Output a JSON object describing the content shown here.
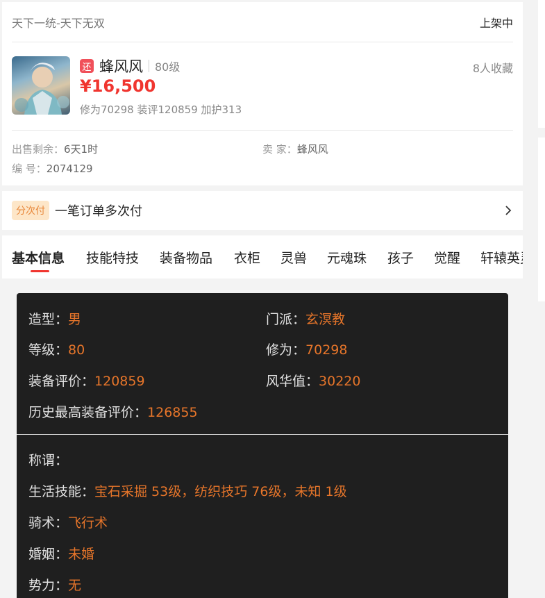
{
  "header": {
    "server": "天下一统-天下无双",
    "status": "上架中"
  },
  "role": {
    "badge": "还",
    "name": "蜂风风",
    "level": "80级",
    "favorites": "8人收藏",
    "price": "¥16,500",
    "summary": "修为70298 装评120859 加护313"
  },
  "meta": {
    "remaining_label": "出售剩余：",
    "remaining_value": "6天1时",
    "seller_label": "卖 家：",
    "seller_value": "蜂风风",
    "id_label": "编 号：",
    "id_value": "2074129"
  },
  "installment": {
    "tag": "分次付",
    "text": "一笔订单多次付",
    "icon": "chevron-right-icon"
  },
  "tabs": [
    "基本信息",
    "技能特技",
    "装备物品",
    "衣柜",
    "灵兽",
    "元魂珠",
    "孩子",
    "觉醒",
    "轩辕英灵"
  ],
  "basic": {
    "model_label": "造型：",
    "model_value": "男",
    "school_label": "门派：",
    "school_value": "玄溟教",
    "level_label": "等级：",
    "level_value": "80",
    "cultivation_label": "修为：",
    "cultivation_value": "70298",
    "equip_label": "装备评价：",
    "equip_value": "120859",
    "charm_label": "风华值：",
    "charm_value": "30220",
    "history_label": "历史最高装备评价：",
    "history_value": "126855",
    "title_label": "称谓：",
    "title_value": "",
    "life_label": "生活技能：",
    "life_value": "宝石采掘 53级，纺织技巧 76级，未知 1级",
    "riding_label": "骑术：",
    "riding_value": "飞行术",
    "marriage_label": "婚姻：",
    "marriage_value": "未婚",
    "force_label": "势力：",
    "force_value": "无"
  },
  "colors": {
    "accent_red": "#f0352f",
    "value_orange": "#e6752a",
    "panel_bg": "#1f1f1f"
  }
}
